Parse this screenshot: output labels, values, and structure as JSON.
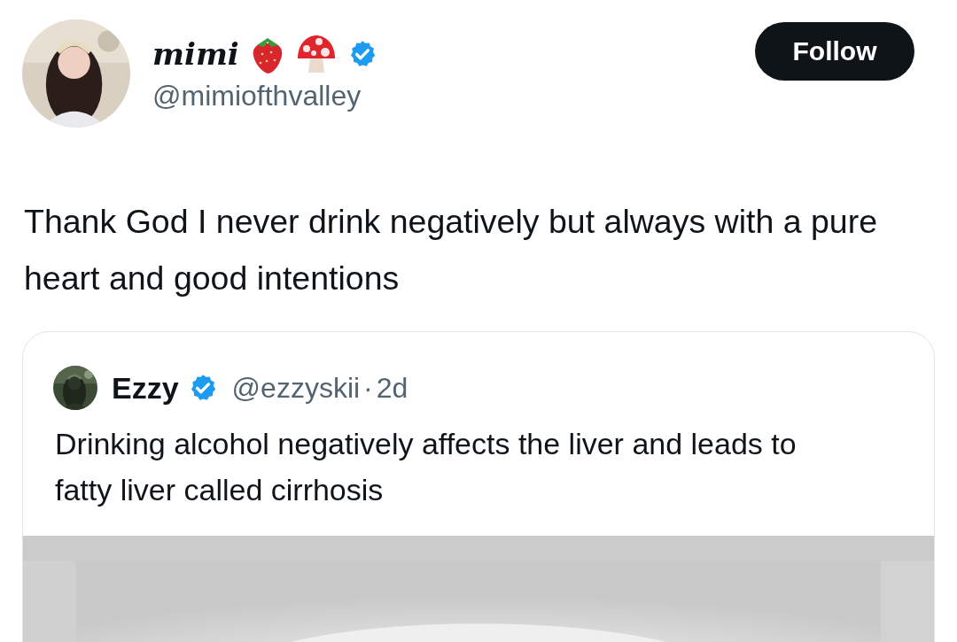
{
  "author": {
    "name": "mimi",
    "handle": "@mimiofthvalley",
    "verified": true
  },
  "follow_button": "Follow",
  "text": "Thank God I never drink negatively but always with a pure heart and good intentions",
  "quoted_tweet": {
    "author": {
      "name": "Ezzy",
      "handle": "@ezzyskii",
      "verified": true
    },
    "separator": "·",
    "time": "2d",
    "text": "Drinking alcohol negatively affects the liver and leads to fatty liver called cirrhosis"
  }
}
